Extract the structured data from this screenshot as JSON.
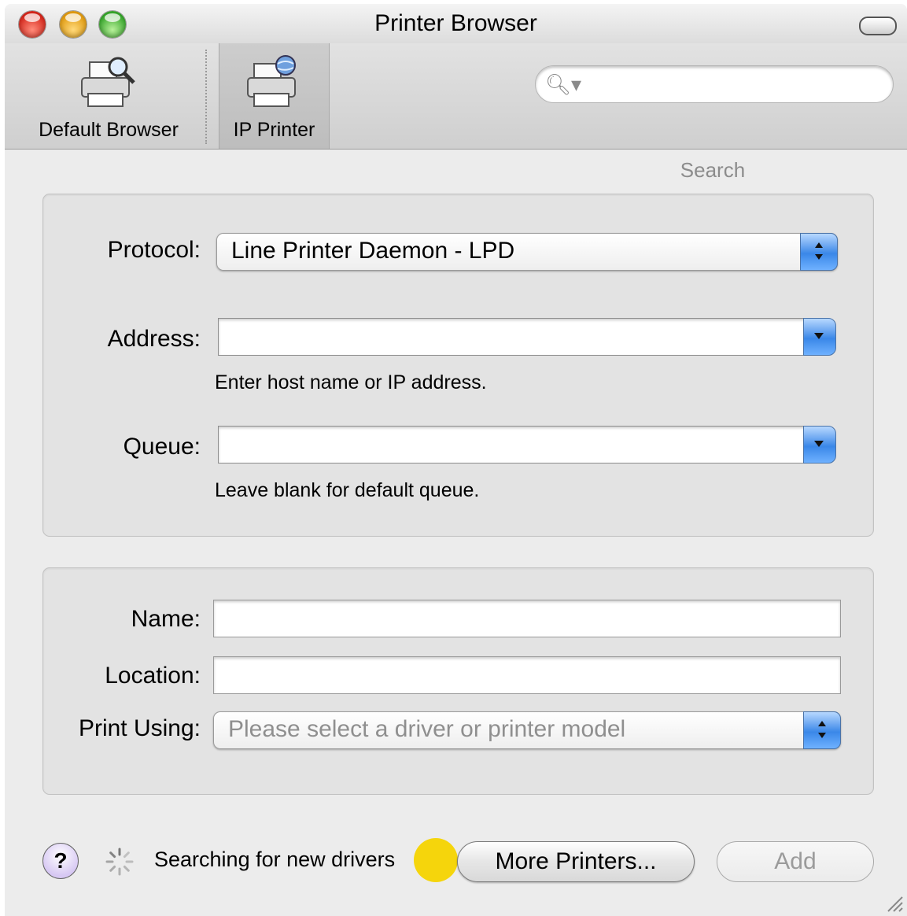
{
  "window": {
    "title": "Printer Browser"
  },
  "toolbar": {
    "items": [
      {
        "label": "Default Browser",
        "icon": "printer-magnifier-icon"
      },
      {
        "label": "IP Printer",
        "icon": "printer-globe-icon",
        "selected": true
      }
    ],
    "search": {
      "placeholder": "",
      "label": "Search"
    }
  },
  "ip_group": {
    "protocol": {
      "label": "Protocol:",
      "value": "Line Printer Daemon - LPD"
    },
    "address": {
      "label": "Address:",
      "value": "",
      "hint": "Enter host name or IP address."
    },
    "queue": {
      "label": "Queue:",
      "value": "",
      "hint": "Leave blank for default queue."
    }
  },
  "info_group": {
    "name": {
      "label": "Name:",
      "value": ""
    },
    "location": {
      "label": "Location:",
      "value": ""
    },
    "print_using": {
      "label": "Print Using:",
      "value": "Please select a driver or printer model"
    }
  },
  "footer": {
    "help_label": "?",
    "status": "Searching for new drivers",
    "more_label": "More Printers...",
    "add_label": "Add"
  },
  "colors": {
    "accent": "#3a87e8",
    "cursor_highlight": "#f5d400"
  }
}
